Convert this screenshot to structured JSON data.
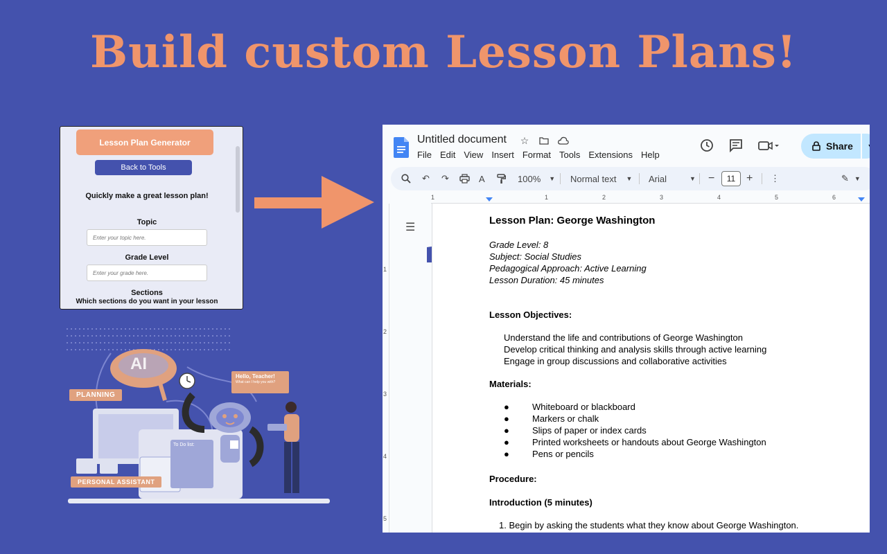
{
  "hero": {
    "title": "Build custom Lesson Plans!"
  },
  "generator": {
    "header": "Lesson Plan Generator",
    "back_button": "Back to Tools",
    "tagline": "Quickly make a great lesson plan!",
    "topic_label": "Topic",
    "topic_placeholder": "Enter your topic here.",
    "grade_label": "Grade Level",
    "grade_placeholder": "Enter your grade here.",
    "sections_label": "Sections",
    "sections_question": "Which sections do you want in your lesson"
  },
  "illustration": {
    "label_planning": "PLANNING",
    "label_assistant": "PERSONAL ASSISTANT",
    "speech_main": "Hello, Teacher!",
    "speech_sub": "What can I help you with?",
    "todo_title": "To Do list:",
    "brain_text": "AI"
  },
  "docs": {
    "title": "Untitled document",
    "menu": [
      "File",
      "Edit",
      "View",
      "Insert",
      "Format",
      "Tools",
      "Extensions",
      "Help"
    ],
    "share_label": "Share",
    "toolbar": {
      "zoom": "100%",
      "style": "Normal text",
      "font": "Arial",
      "font_size": "11"
    },
    "ruler_numbers": [
      "1",
      "1",
      "2",
      "3",
      "4",
      "5",
      "6"
    ],
    "vruler_numbers": [
      "1",
      "2",
      "3",
      "4",
      "5"
    ],
    "content": {
      "heading": "Lesson Plan: George Washington",
      "meta": [
        "Grade Level: 8",
        "Subject: Social Studies",
        "Pedagogical Approach: Active Learning",
        "Lesson Duration: 45 minutes"
      ],
      "objectives_heading": "Lesson Objectives:",
      "objectives": [
        "Understand the life and contributions of George Washington",
        "Develop critical thinking and analysis skills through active learning",
        "Engage in group discussions and collaborative activities"
      ],
      "materials_heading": "Materials:",
      "bullet_char": "●",
      "materials": [
        "Whiteboard or blackboard",
        "Markers or chalk",
        "Slips of paper or index cards",
        "Printed worksheets or handouts about George Washington",
        "Pens or pencils"
      ],
      "procedure_heading": "Procedure:",
      "intro_heading": "Introduction (5 minutes)",
      "intro_steps": [
        "1. Begin by asking the students what they know about George Washington."
      ]
    }
  },
  "colors": {
    "background": "#4452ad",
    "accent_orange": "#f0956b",
    "share_blue": "#c2e7ff"
  }
}
